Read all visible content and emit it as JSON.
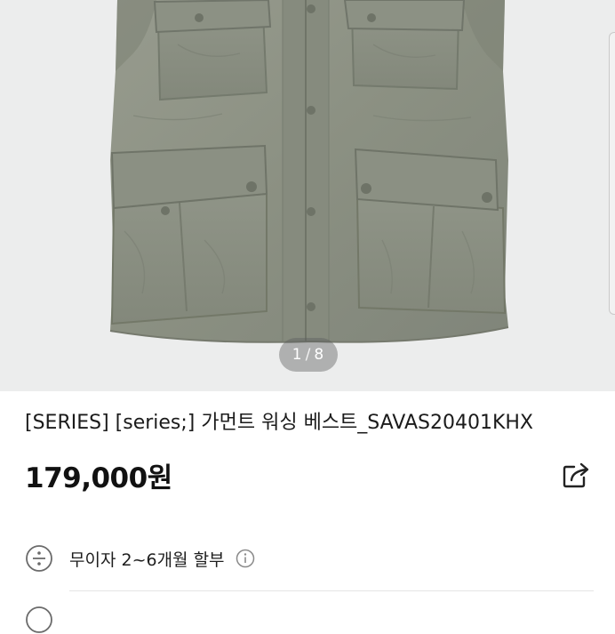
{
  "gallery": {
    "current": "1",
    "separator": "/",
    "total": "8"
  },
  "product": {
    "title": "[SERIES] [series;] 가먼트 워싱 베스트_SAVAS20401KHX",
    "price": "179,000원"
  },
  "installment": {
    "text": "무이자 2~6개월 할부"
  },
  "next_row": {
    "text": " "
  },
  "colors": {
    "vest": "#8e9384",
    "background": "#eceded"
  },
  "icons": {
    "share": "share-icon",
    "installment": "divide-icon",
    "info": "info-icon"
  }
}
